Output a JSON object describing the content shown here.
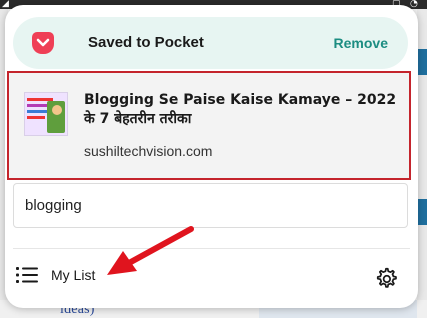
{
  "header": {
    "title": "Saved to Pocket",
    "remove_label": "Remove"
  },
  "article": {
    "title": "Blogging Se Paise Kaise Kamaye – 2022 के 7 बेहतरीन तरीका",
    "domain": "sushiltechvision.com"
  },
  "tags": {
    "value": "blogging"
  },
  "footer": {
    "my_list_label": "My List"
  },
  "background": {
    "peek_text": "ideas)"
  },
  "colors": {
    "pocket_red": "#ef3f56",
    "accent_teal": "#1c8d82",
    "header_bg": "#e7f5f2",
    "highlight_border": "#c4242c",
    "arrow_red": "#e0141e"
  },
  "icons": {
    "pocket": "pocket-icon",
    "list": "list-icon",
    "settings": "gear-icon"
  }
}
